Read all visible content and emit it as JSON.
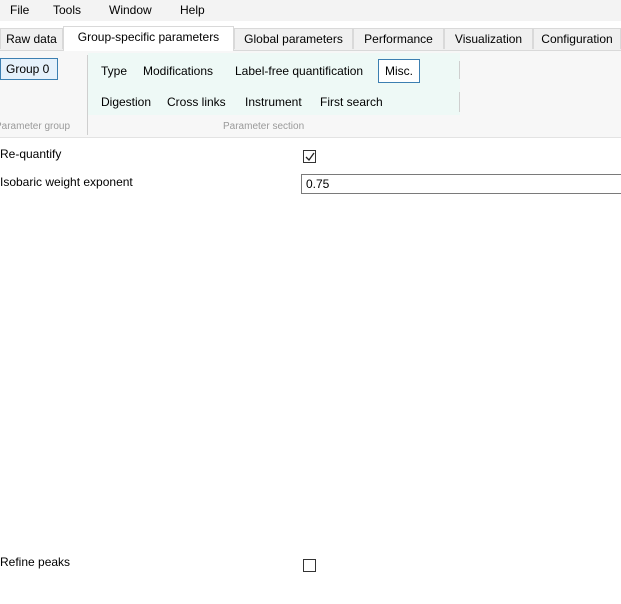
{
  "menu": {
    "file": "File",
    "tools": "Tools",
    "window": "Window",
    "help": "Help"
  },
  "tabs": [
    {
      "label": "Raw data",
      "active": false
    },
    {
      "label": "Group-specific parameters",
      "active": true
    },
    {
      "label": "Global parameters",
      "active": false
    },
    {
      "label": "Performance",
      "active": false
    },
    {
      "label": "Visualization",
      "active": false
    },
    {
      "label": "Configuration",
      "active": false
    }
  ],
  "ribbon": {
    "group_button": "Group 0",
    "group_label": "Parameter group",
    "section_label": "Parameter section",
    "sections_row1": [
      "Type",
      "Modifications",
      "Label-free quantification",
      "Misc."
    ],
    "sections_row2": [
      "Digestion",
      "Cross links",
      "Instrument",
      "First search"
    ],
    "selected_section": "Misc."
  },
  "params": {
    "requantify": {
      "label": "Re-quantify",
      "checked": true
    },
    "isobaric": {
      "label": "Isobaric weight exponent",
      "value": "0.75"
    },
    "refine": {
      "label": "Refine peaks",
      "checked": false
    }
  },
  "colors": {
    "accent": "#3c7fb1",
    "section_bg": "#eef9f6",
    "selected_bg": "#e5f1fb"
  }
}
